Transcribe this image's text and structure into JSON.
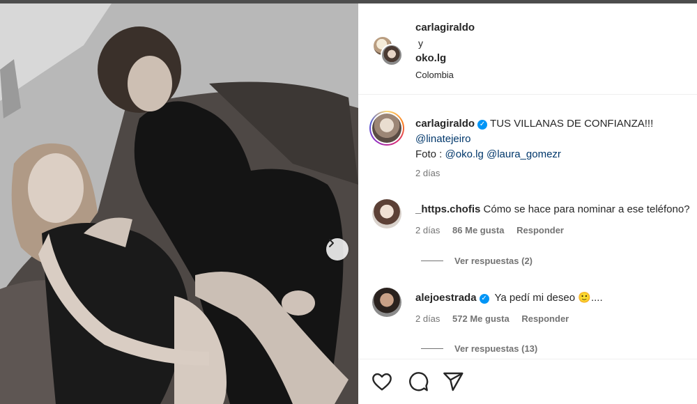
{
  "post": {
    "header": {
      "user1": "carlagiraldo",
      "connector": "y",
      "user2": "oko.lg",
      "location": "Colombia"
    },
    "caption": {
      "username": "carlagiraldo",
      "text": "TUS VILLANAS DE CONFIANZA!!!",
      "mention1": "@linatejeiro",
      "foto_prefix": "Foto : ",
      "mention2": "@oko.lg",
      "mention3": "@laura_gomezr",
      "time": "2 días"
    },
    "comments": [
      {
        "username": "_https.chofis",
        "text": "Cómo se hace para nominar a ese teléfono?",
        "time": "2 días",
        "likes": "86 Me gusta",
        "reply": "Responder",
        "view_replies": "Ver respuestas (2)"
      },
      {
        "username": "alejoestrada",
        "text": "Ya pedí mi deseo",
        "emoji": "🙂",
        "trailing": "....",
        "time": "2 días",
        "likes": "572 Me gusta",
        "reply": "Responder",
        "view_replies": "Ver respuestas (13)"
      }
    ],
    "icons": {
      "like": "heart-icon",
      "comment": "comment-icon",
      "share": "share-icon",
      "next": "chevron-right-icon",
      "verified": "verified-badge-icon"
    }
  }
}
